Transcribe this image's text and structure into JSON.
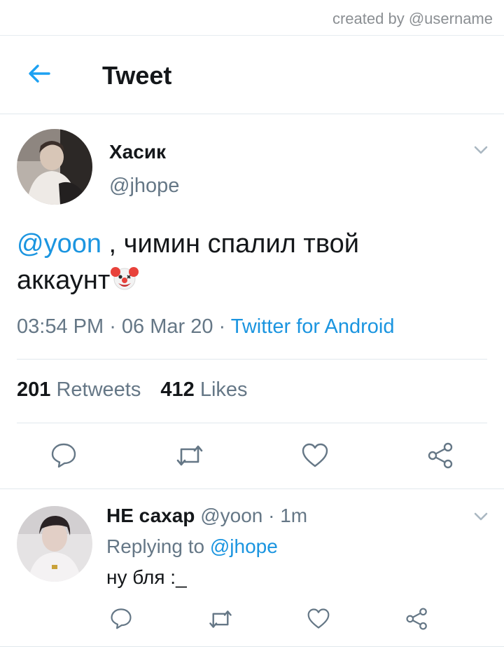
{
  "credit": "created by @username",
  "header": {
    "title": "Tweet"
  },
  "tweet": {
    "name": "Хасик",
    "handle": "@jhope",
    "mention": "@yoon",
    "text_line1": " , чимин спалил твой",
    "text_line2": "аккаунт",
    "emoji": "clown-face-icon",
    "time": "03:54 PM",
    "sep1": " · ",
    "date": "06 Mar 20",
    "sep2": " · ",
    "source": "Twitter for Android",
    "retweets_count": "201",
    "retweets_label": "Retweets",
    "likes_count": "412",
    "likes_label": "Likes"
  },
  "reply": {
    "name": "НЕ сахар",
    "handle": "@yoon",
    "dot": " · ",
    "time": "1m",
    "replying_prefix": "Replying to ",
    "replying_to": "@jhope",
    "text": "ну бля :_"
  },
  "colors": {
    "accent": "#1b95e0",
    "muted": "#657786",
    "divider": "#e1e8ed"
  }
}
